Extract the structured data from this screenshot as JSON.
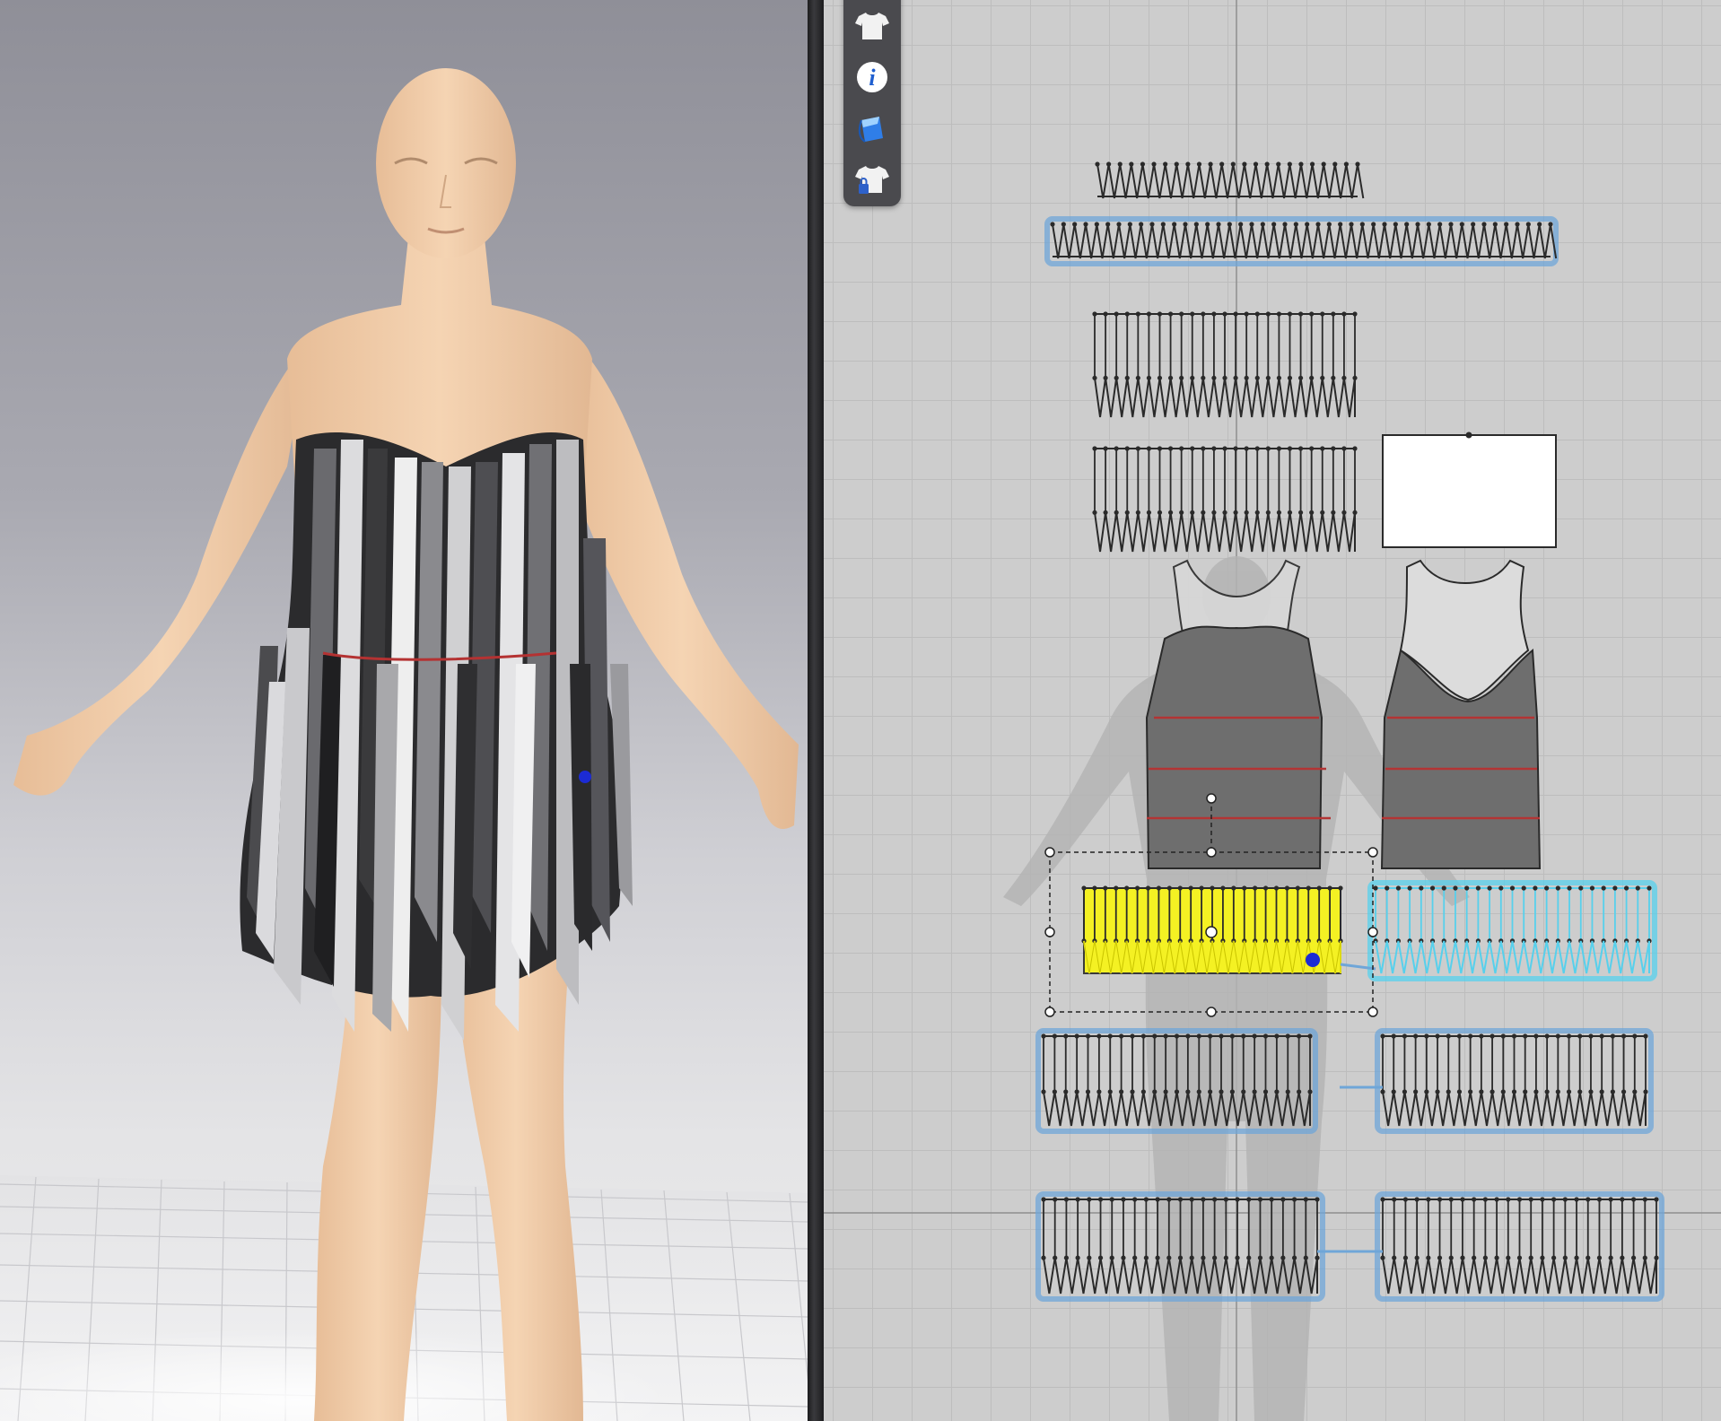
{
  "app": {
    "layout": "split-view",
    "left_panel": "3d-viewport",
    "right_panel": "2d-pattern-window"
  },
  "toolbar": {
    "items": [
      {
        "name": "garment-icon",
        "label": ""
      },
      {
        "name": "info-icon",
        "label": "i"
      },
      {
        "name": "fabric-icon",
        "label": ""
      },
      {
        "name": "locked-garment-icon",
        "label": ""
      }
    ]
  },
  "colors": {
    "skin": "#f2cfac",
    "selected_pattern": "#f4f123",
    "selected_stitch": "#57d0ec",
    "linked_outline": "#6fa6d8",
    "pattern_fill": "#6e6e6e",
    "internal_line": "#b33434",
    "grid_background": "#cdcdcd"
  },
  "patterns": {
    "fringe_strips": 10,
    "bodice_pieces": 2,
    "blank_rect": 1,
    "selected_index": 4
  }
}
